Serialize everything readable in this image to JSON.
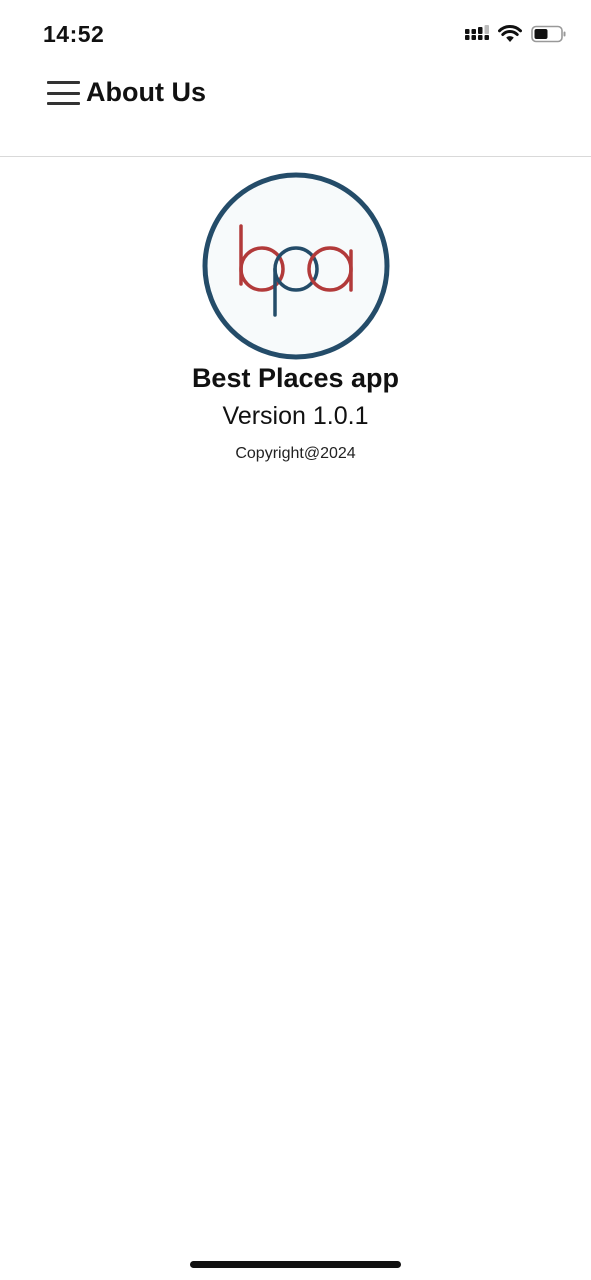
{
  "status_bar": {
    "time": "14:52",
    "icons": [
      "signal-icon",
      "wifi-icon",
      "battery-icon"
    ],
    "battery_level": 0.5
  },
  "header": {
    "menu_icon": "hamburger-menu-icon",
    "title": "About Us"
  },
  "about": {
    "logo_text": "bpa",
    "app_name": "Best Places app",
    "version": "Version 1.0.1",
    "copyright": "Copyright@2024"
  },
  "colors": {
    "logo_ring": "#244C69",
    "logo_red": "#B23A3A",
    "logo_blue": "#244C69",
    "divider": "#D9D9D9"
  }
}
